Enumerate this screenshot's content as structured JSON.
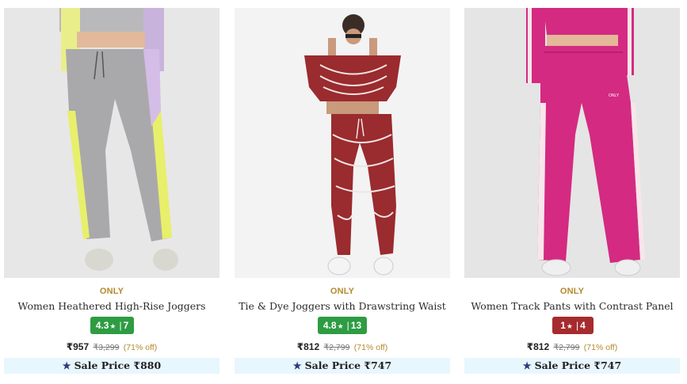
{
  "products": [
    {
      "brand": "ONLY",
      "name": "Women Heathered High-Rise Joggers",
      "rating": "4.3",
      "reviews": "7",
      "rating_color": "#2e9c42",
      "price": "₹957",
      "mrp": "₹3,299",
      "discount": "(71% off)",
      "sale_label": "Sale Price",
      "sale_price": "₹880"
    },
    {
      "brand": "ONLY",
      "name": "Tie & Dye Joggers with Drawstring Waist",
      "rating": "4.8",
      "reviews": "13",
      "rating_color": "#2e9c42",
      "price": "₹812",
      "mrp": "₹2,799",
      "discount": "(71% off)",
      "sale_label": "Sale Price",
      "sale_price": "₹747"
    },
    {
      "brand": "ONLY",
      "name": "Women Track Pants with Contrast Panel",
      "rating": "1",
      "reviews": "4",
      "rating_color": "#a62b2e",
      "price": "₹812",
      "mrp": "₹2,799",
      "discount": "(71% off)",
      "sale_label": "Sale Price",
      "sale_price": "₹747"
    }
  ],
  "icons": {
    "rating_star": "star-icon",
    "sale_star": "star-icon"
  },
  "colors": {
    "brand": "#b5892c",
    "sale_bg": "#e8f6fd",
    "sale_star": "#2c3a7a"
  }
}
